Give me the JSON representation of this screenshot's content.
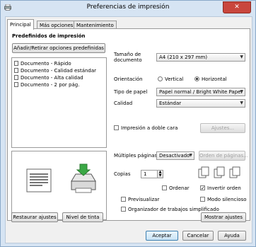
{
  "window": {
    "title": "Preferencias de impresión",
    "close_label": "✕"
  },
  "tabs": [
    {
      "label": "Principal",
      "active": true
    },
    {
      "label": "Más opciones",
      "active": false
    },
    {
      "label": "Mantenimiento",
      "active": false
    }
  ],
  "presets": {
    "heading": "Predefinidos de impresión",
    "add_remove_button": "Añadir/Retirar opciones predefinidas",
    "items": [
      "Documento - Rápido",
      "Documento - Calidad estándar",
      "Documento - Alta calidad",
      "Documento - 2 por pág."
    ]
  },
  "settings": {
    "paper_size_label": "Tamaño de documento",
    "paper_size_value": "A4 (210 x 297 mm)",
    "orientation_label": "Orientación",
    "orientation_vertical": "Vertical",
    "orientation_horizontal": "Horizontal",
    "orientation_selected": "Horizontal",
    "paper_type_label": "Tipo de papel",
    "paper_type_value": "Papel normal / Bright White Paper",
    "quality_label": "Calidad",
    "quality_value": "Estándar",
    "duplex_label": "Impresión a doble cara",
    "duplex_settings_button": "Ajustes...",
    "multipage_label": "Múltiples páginas",
    "multipage_value": "Desactivado",
    "page_order_button": "Orden de páginas...",
    "copies_label": "Copias",
    "copies_value": "1",
    "collate_label": "Ordenar",
    "reverse_order_label": "Invertir orden",
    "reverse_order_checked": true,
    "preview_label": "Previsualizar",
    "quiet_mode_label": "Modo silencioso",
    "job_arranger_label": "Organizador de trabajos simplificado"
  },
  "bottom_panel": {
    "restore_button": "Restaurar ajustes",
    "ink_level_button": "Nivel de tinta",
    "show_settings_button": "Mostrar ajustes"
  },
  "dialog_buttons": {
    "ok": "Aceptar",
    "cancel": "Cancelar",
    "help": "Ayuda"
  }
}
